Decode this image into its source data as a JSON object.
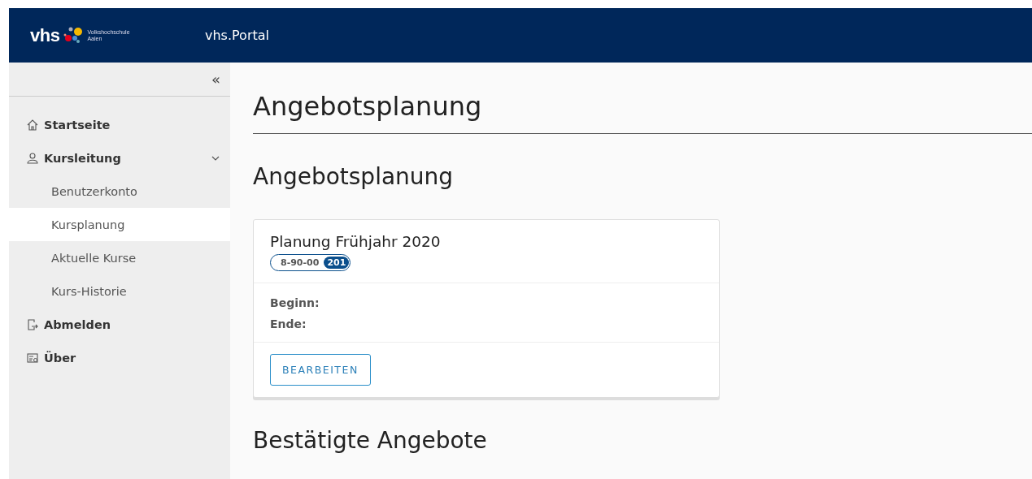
{
  "header": {
    "logo_text": "vhs",
    "logo_org": "Volkshochschule",
    "logo_city": "Aalen",
    "app_title": "vhs.Portal"
  },
  "sidebar": {
    "collapse": "«",
    "items": [
      {
        "label": "Startseite",
        "kind": "top",
        "selected": false
      },
      {
        "label": "Kursleitung",
        "kind": "top",
        "selected": false,
        "expanded": true,
        "children": [
          {
            "label": "Benutzerkonto",
            "kind": "sub",
            "selected": false
          },
          {
            "label": "Kursplanung",
            "kind": "sub",
            "selected": true
          },
          {
            "label": "Aktuelle Kurse",
            "kind": "sub",
            "selected": false
          },
          {
            "label": "Kurs-Historie",
            "kind": "sub",
            "selected": false
          }
        ]
      },
      {
        "label": "Abmelden",
        "kind": "top",
        "selected": false
      },
      {
        "label": "Über",
        "kind": "top",
        "selected": false
      }
    ]
  },
  "main": {
    "page_title": "Angebotsplanung",
    "section_title": "Angebotsplanung",
    "card": {
      "title": "Planung Frühjahr 2020",
      "tag_label": "8-90-00",
      "tag_count": "201",
      "fields": [
        "Beginn:",
        "Ende:"
      ],
      "button": "BEARBEITEN"
    },
    "next_section_title": "Bestätigte Angebote"
  }
}
